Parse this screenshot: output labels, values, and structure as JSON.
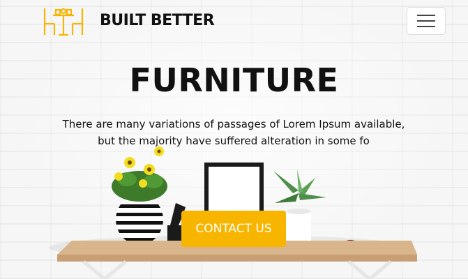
{
  "brand": {
    "name": "BUILT BETTER",
    "logo_icon": "table-chairs-icon"
  },
  "nav": {
    "toggle_icon": "hamburger-menu-icon"
  },
  "hero": {
    "title": "FURNITURE",
    "subtitle": "There are many variations of passages of Lorem Ipsum available, but the majority have suffered alteration in some fo",
    "cta_label": "CONTACT US"
  },
  "colors": {
    "accent": "#f7b500",
    "text": "#111111",
    "background": "#f4f4f4"
  }
}
